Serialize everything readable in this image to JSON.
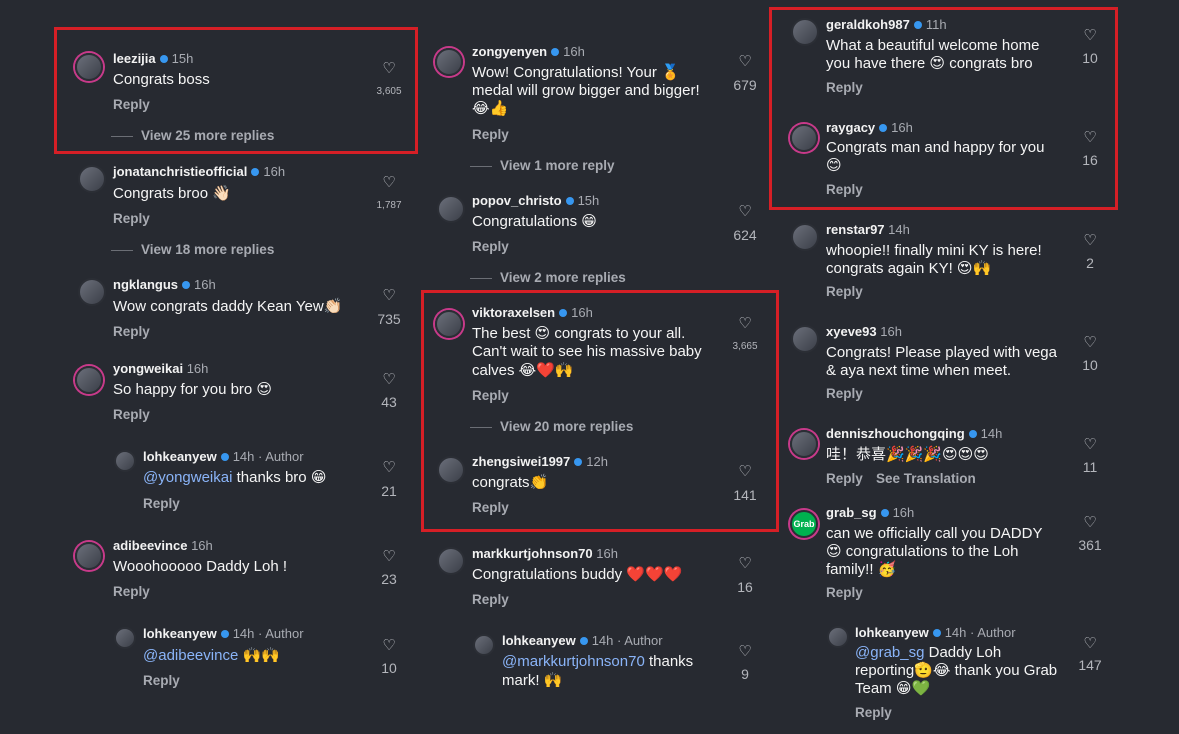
{
  "common": {
    "reply_label": "Reply",
    "see_translation": "See Translation",
    "heart_glyph": "♡",
    "author_label": "· Author"
  },
  "col1": {
    "c1": {
      "user": "leezijia",
      "time": "15h",
      "text": "Congrats boss",
      "likes": "3,605",
      "more": "View 25 more replies"
    },
    "c2": {
      "user": "jonatanchristieofficial",
      "time": "16h",
      "text": "Congrats broo 👋🏻",
      "likes": "1,787",
      "more": "View 18 more replies"
    },
    "c3": {
      "user": "ngklangus",
      "time": "16h",
      "text": "Wow congrats daddy Kean Yew👏🏻",
      "likes": "735"
    },
    "c4": {
      "user": "yongweikai",
      "time": "16h",
      "text": "So happy for you bro 😍",
      "likes": "43"
    },
    "c5": {
      "user": "lohkeanyew",
      "time": "14h",
      "mention": "@yongweikai",
      "text": " thanks bro 😁",
      "likes": "21"
    },
    "c6": {
      "user": "adibeevince",
      "time": "16h",
      "text": "Wooohooooo Daddy Loh !",
      "likes": "23"
    },
    "c7": {
      "user": "lohkeanyew",
      "time": "14h",
      "mention": "@adibeevince",
      "text": " 🙌🙌",
      "likes": "10"
    }
  },
  "col2": {
    "c1": {
      "user": "zongyenyen",
      "time": "16h",
      "line1": "Wow! Congratulations! Your 🏅",
      "line2": "medal will grow bigger and bigger!",
      "line3": "😂👍",
      "likes": "679",
      "more": "View 1 more reply"
    },
    "c2": {
      "user": "popov_christo",
      "time": "15h",
      "text": "Congratulations 😁",
      "likes": "624",
      "more": "View 2 more replies"
    },
    "c3": {
      "user": "viktoraxelsen",
      "time": "16h",
      "line1": "The best 😍 congrats to your all.",
      "line2": "Can't wait to see his massive baby",
      "line3": "calves 😂❤️🙌",
      "likes": "3,665",
      "more": "View 20 more replies"
    },
    "c4": {
      "user": "zhengsiwei1997",
      "time": "12h",
      "text": "congrats👏",
      "likes": "141"
    },
    "c5": {
      "user": "markkurtjohnson70",
      "time": "16h",
      "text": "Congratulations buddy ❤️❤️❤️",
      "likes": "16"
    },
    "c6": {
      "user": "lohkeanyew",
      "time": "14h",
      "mention": "@markkurtjohnson70",
      "line1": " thanks",
      "line2": "mark! 🙌",
      "likes": "9"
    }
  },
  "col3": {
    "c1": {
      "user": "geraldkoh987",
      "time": "11h",
      "line1": "What a beautiful welcome home",
      "line2": "you have there 😍 congrats bro",
      "likes": "10"
    },
    "c2": {
      "user": "raygacy",
      "time": "16h",
      "line1": "Congrats man and happy for you",
      "line2": "😊",
      "likes": "16"
    },
    "c3": {
      "user": "renstar97",
      "time": "14h",
      "line1": "whoopie!! finally mini KY is here!",
      "line2": "congrats again KY! 😍🙌",
      "likes": "2"
    },
    "c4": {
      "user": "xyeve93",
      "time": "16h",
      "line1": "Congrats! Please played with vega",
      "line2": "& aya next time when meet.",
      "likes": "10"
    },
    "c5": {
      "user": "denniszhouchongqing",
      "time": "14h",
      "text": "哇！恭喜🎉🎉🎉😍😍😍",
      "likes": "11"
    },
    "c6": {
      "user": "grab_sg",
      "time": "16h",
      "avatar_text": "Grab",
      "line1": "can we officially call you DADDY",
      "line2": "😍 congratulations to the Loh",
      "line3": "family!! 🥳",
      "likes": "361"
    },
    "c7": {
      "user": "lohkeanyew",
      "time": "14h",
      "mention": "@grab_sg",
      "line1": " Daddy Loh",
      "line2": "reporting🫡😂 thank you Grab",
      "line3": "Team 😁💚",
      "likes": "147"
    }
  },
  "colors": {
    "background": "#272a31",
    "highlight_box": "#d61f26",
    "verified": "#3797f0"
  }
}
